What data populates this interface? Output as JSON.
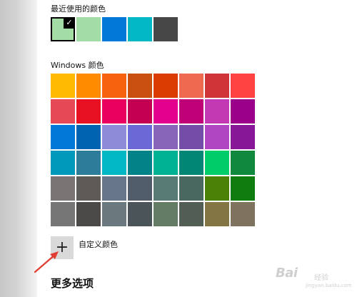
{
  "recent": {
    "label": "最近使用的颜色",
    "colors": [
      "#a3dca4",
      "#a3dca4",
      "#0078d7",
      "#00b7c3",
      "#474747"
    ],
    "selected_index": 0,
    "check_icon": "✓"
  },
  "windows": {
    "label": "Windows 颜色",
    "colors": [
      "#ffb900",
      "#ff8c00",
      "#f7630c",
      "#ca5010",
      "#da3b01",
      "#ef6950",
      "#d13438",
      "#ff4343",
      "#e74856",
      "#e81123",
      "#ea005e",
      "#c30052",
      "#e3008c",
      "#bf0077",
      "#c239b3",
      "#9a0089",
      "#0078d7",
      "#0063b1",
      "#8e8cd8",
      "#6b69d6",
      "#8764b8",
      "#744da9",
      "#b146c2",
      "#881798",
      "#0099bc",
      "#2d7d9a",
      "#00b7c3",
      "#038387",
      "#00b294",
      "#018574",
      "#00cc6a",
      "#10893e",
      "#7a7574",
      "#5d5a58",
      "#68768a",
      "#515c6b",
      "#567c73",
      "#486860",
      "#498205",
      "#107c10",
      "#767676",
      "#4c4a48",
      "#69797e",
      "#4a5459",
      "#647c64",
      "#525e54",
      "#847545",
      "#7e735f"
    ]
  },
  "custom": {
    "plus_icon": "+",
    "label": "自定义颜色"
  },
  "more": {
    "title": "更多选项"
  },
  "watermark": {
    "brand": "Bai",
    "sub": "经验",
    "url": "jingyan.baidu.com"
  },
  "annotation_color": "#e03c31"
}
